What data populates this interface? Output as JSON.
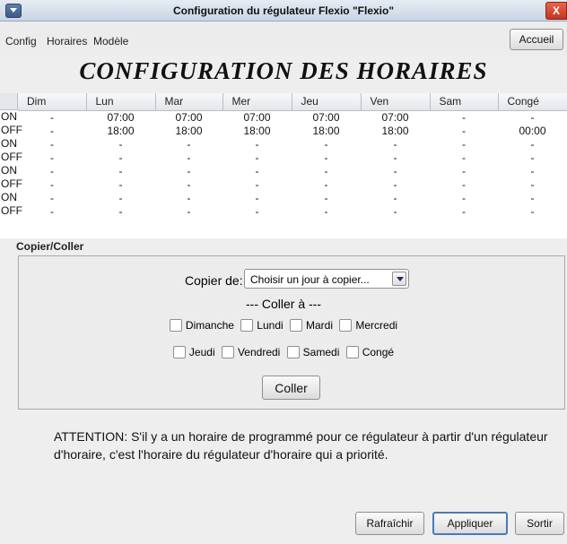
{
  "window": {
    "title": "Configuration du régulateur Flexio \"Flexio\"",
    "close_label": "X"
  },
  "menu": {
    "items": [
      "Config",
      "Horaires",
      "Modèle"
    ],
    "home_button": "Accueil"
  },
  "page_title": "CONFIGURATION DES HORAIRES",
  "schedule": {
    "columns": [
      "Dim",
      "Lun",
      "Mar",
      "Mer",
      "Jeu",
      "Ven",
      "Sam",
      "Congé"
    ],
    "rows": [
      {
        "label": "ON",
        "values": [
          "-",
          "07:00",
          "07:00",
          "07:00",
          "07:00",
          "07:00",
          "-",
          "-"
        ]
      },
      {
        "label": "OFF",
        "values": [
          "-",
          "18:00",
          "18:00",
          "18:00",
          "18:00",
          "18:00",
          "-",
          "00:00"
        ]
      },
      {
        "label": "ON",
        "values": [
          "-",
          "-",
          "-",
          "-",
          "-",
          "-",
          "-",
          "-"
        ]
      },
      {
        "label": "OFF",
        "values": [
          "-",
          "-",
          "-",
          "-",
          "-",
          "-",
          "-",
          "-"
        ]
      },
      {
        "label": "ON",
        "values": [
          "-",
          "-",
          "-",
          "-",
          "-",
          "-",
          "-",
          "-"
        ]
      },
      {
        "label": "OFF",
        "values": [
          "-",
          "-",
          "-",
          "-",
          "-",
          "-",
          "-",
          "-"
        ]
      },
      {
        "label": "ON",
        "values": [
          "-",
          "-",
          "-",
          "-",
          "-",
          "-",
          "-",
          "-"
        ]
      },
      {
        "label": "OFF",
        "values": [
          "-",
          "-",
          "-",
          "-",
          "-",
          "-",
          "-",
          "-"
        ]
      }
    ]
  },
  "copy_paste": {
    "section_title": "Copier/Coller",
    "copy_label": "Copier de:",
    "copy_select_value": "Choisir un jour à copier...",
    "paste_heading": "--- Coller à ---",
    "checkboxes_row1": [
      "Dimanche",
      "Lundi",
      "Mardi",
      "Mercredi"
    ],
    "checkboxes_row2": [
      "Jeudi",
      "Vendredi",
      "Samedi",
      "Congé"
    ],
    "paste_button": "Coller"
  },
  "notice": "ATTENTION: S'il y a un horaire de programmé pour ce régulateur à partir d'un régulateur d'horaire, c'est l'horaire du régulateur d'horaire qui a priorité.",
  "footer": {
    "refresh_button": "Rafraîchir",
    "apply_button": "Appliquer",
    "exit_button": "Sortir"
  },
  "colors": {
    "title_bar": "#c9d4e3",
    "close_button": "#c2371f",
    "focus_border": "#4a79b8"
  }
}
